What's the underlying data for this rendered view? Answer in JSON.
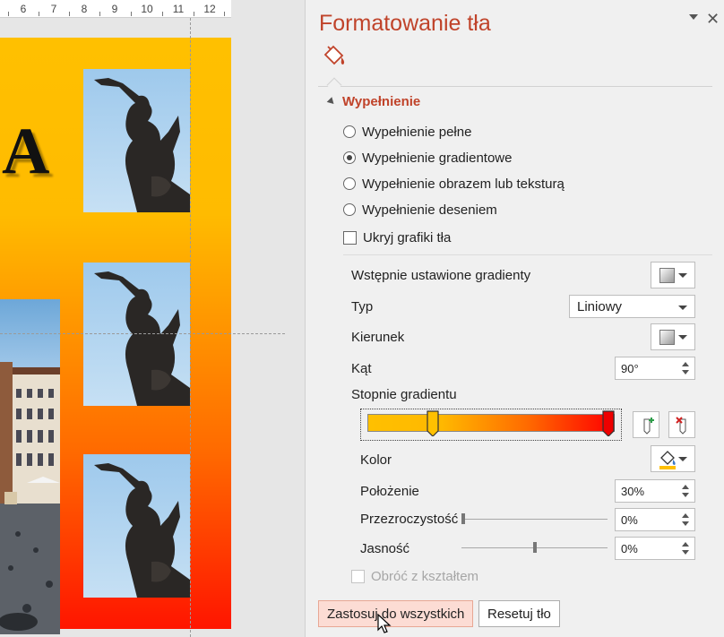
{
  "ruler": {
    "numbers": [
      "6",
      "7",
      "8",
      "9",
      "10",
      "11",
      "12"
    ]
  },
  "slide": {
    "title_fragment": "A"
  },
  "pane": {
    "title": "Formatowanie tła",
    "section_title": "Wypełnienie",
    "fill_options": [
      {
        "label": "Wypełnienie pełne",
        "selected": false
      },
      {
        "label": "Wypełnienie gradientowe",
        "selected": true
      },
      {
        "label": "Wypełnienie obrazem lub teksturą",
        "selected": false
      },
      {
        "label": "Wypełnienie deseniem",
        "selected": false
      }
    ],
    "hide_background_graphics": {
      "label": "Ukryj grafiki tła",
      "checked": false
    },
    "preset_gradients_label": "Wstępnie ustawione gradienty",
    "type": {
      "label": "Typ",
      "value": "Liniowy"
    },
    "direction_label": "Kierunek",
    "angle": {
      "label": "Kąt",
      "value": "90°"
    },
    "gradient_stops_label": "Stopnie gradientu",
    "gradient_stop_positions": [
      0.3,
      1.0
    ],
    "gradient_colors": {
      "start": "#ffc000",
      "end": "#ff0000"
    },
    "color_label": "Kolor",
    "position": {
      "label": "Położenie",
      "value": "30%"
    },
    "transparency": {
      "label": "Przezroczystość",
      "value": "0%",
      "slider_fraction": 0.0
    },
    "brightness": {
      "label": "Jasność",
      "value": "0%",
      "slider_fraction": 0.5
    },
    "rotate_with_shape": {
      "label": "Obróć z kształtem",
      "checked": false,
      "disabled": true
    },
    "apply_all_label": "Zastosuj do wszystkich",
    "reset_label": "Resetuj tło",
    "accent_color": "#c0432a"
  }
}
